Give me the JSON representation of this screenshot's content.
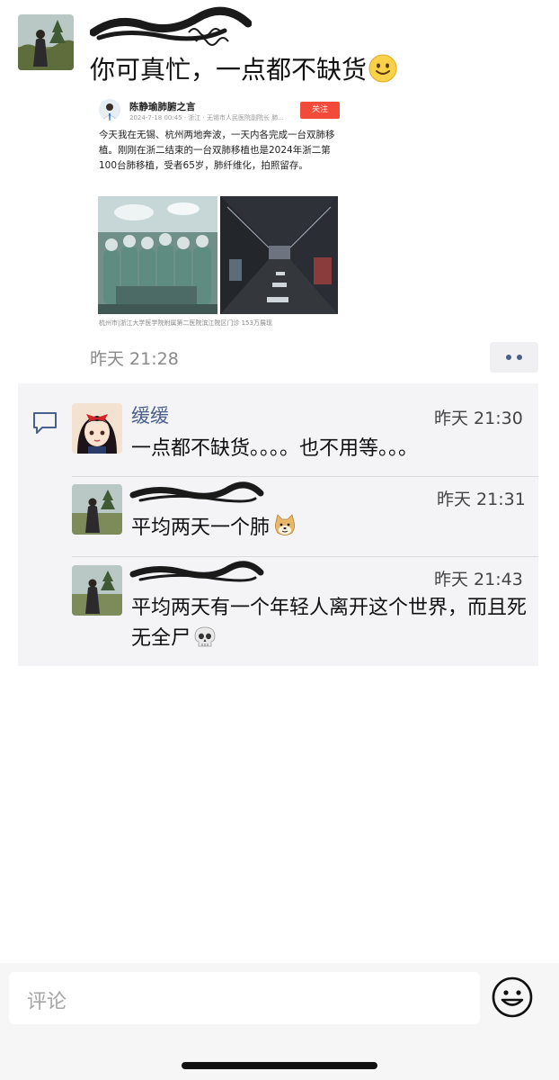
{
  "post": {
    "text": "你可真忙，一点都不缺货",
    "time": "昨天 21:28"
  },
  "shared_card": {
    "author_name": "陈静瑜肺腑之言",
    "meta": "2024-7-18 00:45 · 浙江 · 无锡市人民医院副院长 肺...",
    "follow_label": "关注",
    "body": "今天我在无锡、杭州两地奔波，一天内各完成一台双肺移植。刚刚在浙二结束的一台双肺移植也是2024年浙二第100台肺移植，受者65岁，肺纤维化，拍照留存。",
    "location": "杭州市|浙江大学医学院附属第二医院滨江院区门诊   153万展现"
  },
  "comments": [
    {
      "name": "缓缓",
      "time": "昨天 21:30",
      "text": "一点都不缺货。。。。也不用等。。。"
    },
    {
      "name": "",
      "time": "昨天 21:31",
      "text": "平均两天一个肺"
    },
    {
      "name": "",
      "time": "昨天 21:43",
      "text": "平均两天有一个年轻人离开这个世界，而且死无全尸"
    }
  ],
  "input": {
    "placeholder": "评论"
  },
  "icons": {
    "more": "more-dots-icon",
    "comment": "comment-bubble-icon",
    "emoji": "smiley-face-icon",
    "doge": "doge-emoji-icon",
    "skull": "skull-emoji-icon",
    "smile": "smile-emoji-icon"
  },
  "colors": {
    "name_link": "#4a5f8a",
    "follow_button": "#f24b3a",
    "comment_background": "#f4f4f6"
  }
}
